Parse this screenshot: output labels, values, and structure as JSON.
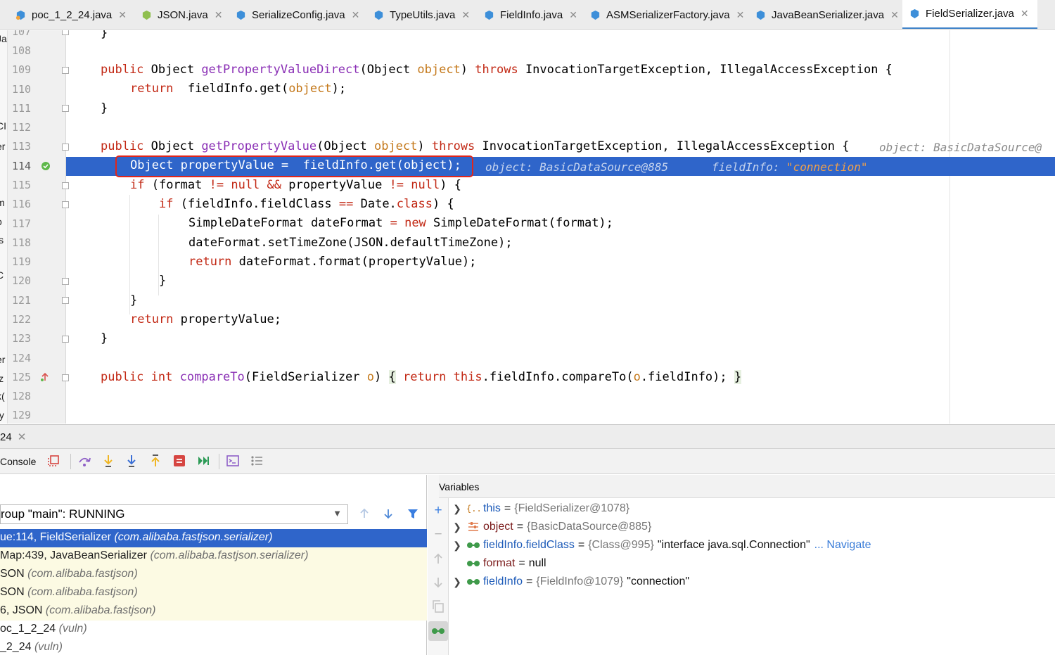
{
  "tabs": [
    {
      "label": "poc_1_2_24.java",
      "icon": "java-class-icon"
    },
    {
      "label": "JSON.java",
      "icon": "java-abstract-class-icon"
    },
    {
      "label": "SerializeConfig.java",
      "icon": "java-class-icon"
    },
    {
      "label": "TypeUtils.java",
      "icon": "java-class-icon"
    },
    {
      "label": "FieldInfo.java",
      "icon": "java-class-icon"
    },
    {
      "label": "ASMSerializerFactory.java",
      "icon": "java-class-icon"
    },
    {
      "label": "JavaBeanSerializer.java",
      "icon": "java-class-icon"
    },
    {
      "label": "FieldSerializer.java",
      "icon": "java-class-icon",
      "active": true
    }
  ],
  "editor": {
    "line_numbers": [
      "107",
      "108",
      "109",
      "110",
      "111",
      "112",
      "113",
      "114",
      "115",
      "116",
      "117",
      "118",
      "119",
      "120",
      "121",
      "122",
      "123",
      "124",
      "125",
      "128",
      "129"
    ],
    "project_fragments": [
      "Ja",
      "",
      "",
      "",
      "",
      "CI",
      "er",
      "",
      "",
      "m",
      "o",
      "ls",
      "",
      "C",
      "",
      "",
      "r",
      "er",
      "iz",
      "k(",
      "ty"
    ],
    "code": {
      "l107": "}",
      "l109": {
        "k1": "public",
        "t1": " Object ",
        "fn": "getPropertyValueDirect",
        "p1": "(Object ",
        "pm": "object",
        "p2": ") ",
        "k2": "throws",
        "rest": " InvocationTargetException, IllegalAccessException {"
      },
      "l110": {
        "k1": "return",
        "a": "  fieldInfo.get(",
        "pm": "object",
        "b": ");"
      },
      "l111": "}",
      "l113": {
        "k1": "public",
        "t1": " Object ",
        "fn": "getPropertyValue",
        "p1": "(Object ",
        "pm": "object",
        "p2": ") ",
        "k2": "throws",
        "rest": " InvocationTargetException, IllegalAccessException {"
      },
      "l114": "Object propertyValue =  fieldInfo.get(object);",
      "l115": {
        "k1": "if",
        "a": " (format ",
        "op1": "!=",
        "b": " ",
        "k2": "null",
        "c": " ",
        "op2": "&&",
        "d": " propertyValue ",
        "op3": "!=",
        "e": " ",
        "k3": "null",
        "f": ") {"
      },
      "l116": {
        "k1": "if",
        "a": " (fieldInfo.fieldClass ",
        "op": "==",
        "b": " Date.",
        "k2": "class",
        "c": ") {"
      },
      "l117": {
        "a": "SimpleDateFormat dateFormat ",
        "op": "=",
        "b": " ",
        "k1": "new",
        "c": " SimpleDateFormat(format);"
      },
      "l118": "dateFormat.setTimeZone(JSON.defaultTimeZone);",
      "l119": {
        "k1": "return",
        "a": " dateFormat.format(propertyValue);"
      },
      "l120": "}",
      "l121": "}",
      "l122": {
        "k1": "return",
        "a": " propertyValue;"
      },
      "l123": "}",
      "l125": {
        "k1": "public",
        "sp": " ",
        "k2": "int",
        "sp2": " ",
        "fn": "compareTo",
        "a": "(FieldSerializer ",
        "pm": "o",
        "b": ") ",
        "lb": "{",
        "c": " ",
        "k3": "return",
        "d": " ",
        "k4": "this",
        "e": ".fieldInfo.compareTo(",
        "pm2": "o",
        "f": ".fieldInfo); ",
        "rb": "}"
      }
    },
    "inline_hints": {
      "l113": "object: BasicDataSource@",
      "l114_object": "object: BasicDataSource@885",
      "l114_fi_name": "fieldInfo: ",
      "l114_fi_value": "\"connection\""
    },
    "colors": {
      "highlight_row": "#2f65ca",
      "callout_box": "#e0261b",
      "keyword": "#c22814",
      "method": "#8a2fb5",
      "param": "#c4781a",
      "string": "#e9a13c"
    }
  },
  "debug": {
    "run_tab": {
      "label": "24"
    },
    "console_tab": "Console",
    "toolbar_buttons": [
      "show-execution-point-icon",
      "step-over-icon",
      "step-into-icon",
      "force-step-into-icon",
      "step-out-icon",
      "drop-frame-icon",
      "run-to-cursor-icon",
      "evaluate-expression-icon",
      "trace-icon"
    ],
    "thread": "roup \"main\": RUNNING",
    "frames": [
      {
        "method": "ue:114, FieldSerializer ",
        "pkg": "(com.alibaba.fastjson.serializer)",
        "state": "selected"
      },
      {
        "method": "Map:439, JavaBeanSerializer ",
        "pkg": "(com.alibaba.fastjson.serializer)",
        "state": "lib"
      },
      {
        "method": "SON ",
        "pkg": "(com.alibaba.fastjson)",
        "state": "lib"
      },
      {
        "method": "SON ",
        "pkg": "(com.alibaba.fastjson)",
        "state": "lib"
      },
      {
        "method": "6, JSON ",
        "pkg": "(com.alibaba.fastjson)",
        "state": "lib"
      },
      {
        "method": "oc_1_2_24 ",
        "pkg": "(vuln)",
        "state": "normal"
      },
      {
        "method": "_2_24 ",
        "pkg": "(vuln)",
        "state": "normal"
      }
    ],
    "variables_title": "Variables",
    "variables": [
      {
        "expandable": true,
        "icon": "object-fields-icon",
        "name": "this",
        "type": "{FieldSerializer@1078}",
        "value": "",
        "navigate": ""
      },
      {
        "expandable": true,
        "icon": "param-list-icon",
        "name": "object",
        "type": "{BasicDataSource@885}",
        "value": "",
        "navigate": "",
        "plain": true
      },
      {
        "expandable": true,
        "icon": "watch-glasses-icon",
        "name": "fieldInfo.fieldClass",
        "type": "{Class@995}",
        "value": "\"interface java.sql.Connection\"",
        "navigate": "... Navigate"
      },
      {
        "expandable": false,
        "icon": "watch-glasses-icon",
        "name": "format",
        "type": "null",
        "value": "",
        "navigate": "",
        "plain": true
      },
      {
        "expandable": true,
        "icon": "watch-glasses-icon",
        "name": "fieldInfo",
        "type": "{FieldInfo@1079}",
        "value": "\"connection\"",
        "navigate": ""
      }
    ]
  }
}
